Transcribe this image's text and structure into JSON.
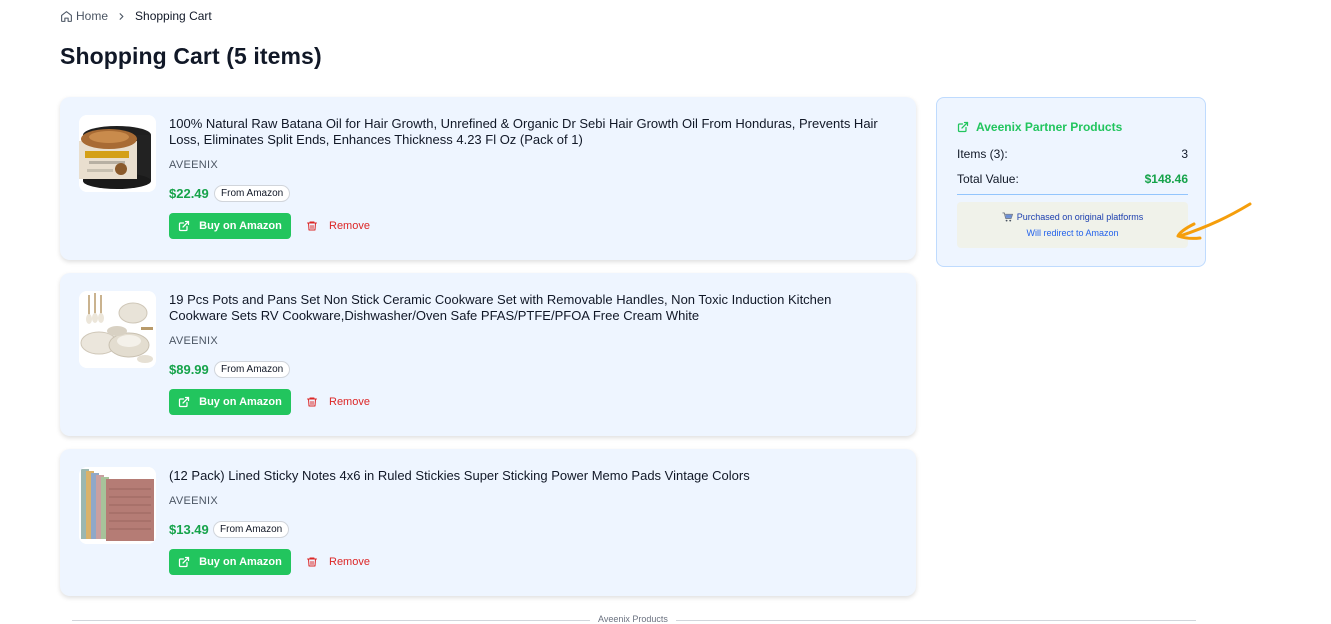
{
  "breadcrumb": {
    "home": "Home",
    "current": "Shopping Cart"
  },
  "page": {
    "title": "Shopping Cart (5 items)"
  },
  "cart": {
    "buy_label": "Buy on Amazon",
    "remove_label": "Remove",
    "items": [
      {
        "title": "100% Natural Raw Batana Oil for Hair Growth, Unrefined & Organic Dr Sebi Hair Growth Oil From Honduras, Prevents Hair Loss, Eliminates Split Ends, Enhances Thickness 4.23 Fl Oz (Pack of 1)",
        "brand": "AVEENIX",
        "price": "$22.49",
        "source": "From Amazon",
        "image": "batana-oil-jar-image"
      },
      {
        "title": "19 Pcs Pots and Pans Set Non Stick Ceramic Cookware Set with Removable Handles, Non Toxic Induction Kitchen Cookware Sets RV Cookware,Dishwasher/Oven Safe PFAS/PTFE/PFOA Free Cream White",
        "brand": "AVEENIX",
        "price": "$89.99",
        "source": "From Amazon",
        "image": "cookware-set-image"
      },
      {
        "title": "(12 Pack) Lined Sticky Notes 4x6 in Ruled Stickies Super Sticking Power Memo Pads Vintage Colors",
        "brand": "AVEENIX",
        "price": "$13.49",
        "source": "From Amazon",
        "image": "sticky-notes-image"
      }
    ]
  },
  "summary": {
    "title": "Aveenix Partner Products",
    "items_label": "Items (3):",
    "items_value": "3",
    "total_label": "Total Value:",
    "total_value": "$148.46",
    "notice_line1": "Purchased on original platforms",
    "notice_line2": "Will redirect to Amazon"
  },
  "footer": {
    "section_label": "Aveenix Products"
  },
  "colors": {
    "accent_green": "#22c55e",
    "price_green": "#16a34a",
    "remove_red": "#dc2626",
    "card_bg": "#eef5ff",
    "annotation_orange": "#f59e0b"
  }
}
